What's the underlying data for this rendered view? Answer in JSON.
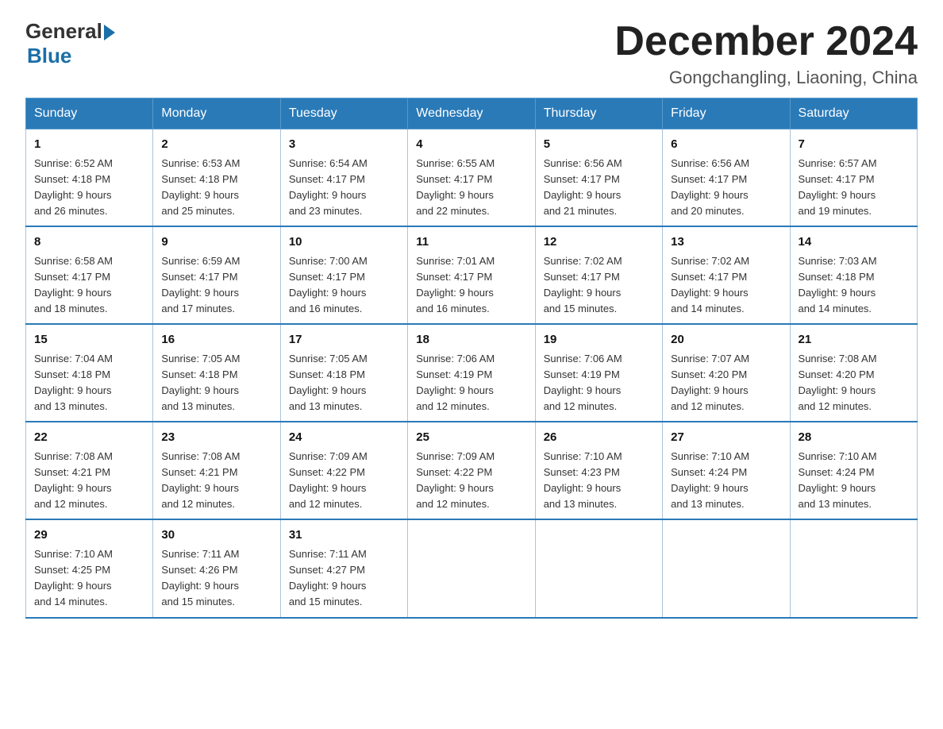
{
  "logo": {
    "general": "General",
    "blue": "Blue"
  },
  "header": {
    "month": "December 2024",
    "location": "Gongchangling, Liaoning, China"
  },
  "days_of_week": [
    "Sunday",
    "Monday",
    "Tuesday",
    "Wednesday",
    "Thursday",
    "Friday",
    "Saturday"
  ],
  "weeks": [
    [
      {
        "day": "1",
        "sunrise": "6:52 AM",
        "sunset": "4:18 PM",
        "daylight": "9 hours and 26 minutes."
      },
      {
        "day": "2",
        "sunrise": "6:53 AM",
        "sunset": "4:18 PM",
        "daylight": "9 hours and 25 minutes."
      },
      {
        "day": "3",
        "sunrise": "6:54 AM",
        "sunset": "4:17 PM",
        "daylight": "9 hours and 23 minutes."
      },
      {
        "day": "4",
        "sunrise": "6:55 AM",
        "sunset": "4:17 PM",
        "daylight": "9 hours and 22 minutes."
      },
      {
        "day": "5",
        "sunrise": "6:56 AM",
        "sunset": "4:17 PM",
        "daylight": "9 hours and 21 minutes."
      },
      {
        "day": "6",
        "sunrise": "6:56 AM",
        "sunset": "4:17 PM",
        "daylight": "9 hours and 20 minutes."
      },
      {
        "day": "7",
        "sunrise": "6:57 AM",
        "sunset": "4:17 PM",
        "daylight": "9 hours and 19 minutes."
      }
    ],
    [
      {
        "day": "8",
        "sunrise": "6:58 AM",
        "sunset": "4:17 PM",
        "daylight": "9 hours and 18 minutes."
      },
      {
        "day": "9",
        "sunrise": "6:59 AM",
        "sunset": "4:17 PM",
        "daylight": "9 hours and 17 minutes."
      },
      {
        "day": "10",
        "sunrise": "7:00 AM",
        "sunset": "4:17 PM",
        "daylight": "9 hours and 16 minutes."
      },
      {
        "day": "11",
        "sunrise": "7:01 AM",
        "sunset": "4:17 PM",
        "daylight": "9 hours and 16 minutes."
      },
      {
        "day": "12",
        "sunrise": "7:02 AM",
        "sunset": "4:17 PM",
        "daylight": "9 hours and 15 minutes."
      },
      {
        "day": "13",
        "sunrise": "7:02 AM",
        "sunset": "4:17 PM",
        "daylight": "9 hours and 14 minutes."
      },
      {
        "day": "14",
        "sunrise": "7:03 AM",
        "sunset": "4:18 PM",
        "daylight": "9 hours and 14 minutes."
      }
    ],
    [
      {
        "day": "15",
        "sunrise": "7:04 AM",
        "sunset": "4:18 PM",
        "daylight": "9 hours and 13 minutes."
      },
      {
        "day": "16",
        "sunrise": "7:05 AM",
        "sunset": "4:18 PM",
        "daylight": "9 hours and 13 minutes."
      },
      {
        "day": "17",
        "sunrise": "7:05 AM",
        "sunset": "4:18 PM",
        "daylight": "9 hours and 13 minutes."
      },
      {
        "day": "18",
        "sunrise": "7:06 AM",
        "sunset": "4:19 PM",
        "daylight": "9 hours and 12 minutes."
      },
      {
        "day": "19",
        "sunrise": "7:06 AM",
        "sunset": "4:19 PM",
        "daylight": "9 hours and 12 minutes."
      },
      {
        "day": "20",
        "sunrise": "7:07 AM",
        "sunset": "4:20 PM",
        "daylight": "9 hours and 12 minutes."
      },
      {
        "day": "21",
        "sunrise": "7:08 AM",
        "sunset": "4:20 PM",
        "daylight": "9 hours and 12 minutes."
      }
    ],
    [
      {
        "day": "22",
        "sunrise": "7:08 AM",
        "sunset": "4:21 PM",
        "daylight": "9 hours and 12 minutes."
      },
      {
        "day": "23",
        "sunrise": "7:08 AM",
        "sunset": "4:21 PM",
        "daylight": "9 hours and 12 minutes."
      },
      {
        "day": "24",
        "sunrise": "7:09 AM",
        "sunset": "4:22 PM",
        "daylight": "9 hours and 12 minutes."
      },
      {
        "day": "25",
        "sunrise": "7:09 AM",
        "sunset": "4:22 PM",
        "daylight": "9 hours and 12 minutes."
      },
      {
        "day": "26",
        "sunrise": "7:10 AM",
        "sunset": "4:23 PM",
        "daylight": "9 hours and 13 minutes."
      },
      {
        "day": "27",
        "sunrise": "7:10 AM",
        "sunset": "4:24 PM",
        "daylight": "9 hours and 13 minutes."
      },
      {
        "day": "28",
        "sunrise": "7:10 AM",
        "sunset": "4:24 PM",
        "daylight": "9 hours and 13 minutes."
      }
    ],
    [
      {
        "day": "29",
        "sunrise": "7:10 AM",
        "sunset": "4:25 PM",
        "daylight": "9 hours and 14 minutes."
      },
      {
        "day": "30",
        "sunrise": "7:11 AM",
        "sunset": "4:26 PM",
        "daylight": "9 hours and 15 minutes."
      },
      {
        "day": "31",
        "sunrise": "7:11 AM",
        "sunset": "4:27 PM",
        "daylight": "9 hours and 15 minutes."
      },
      null,
      null,
      null,
      null
    ]
  ]
}
